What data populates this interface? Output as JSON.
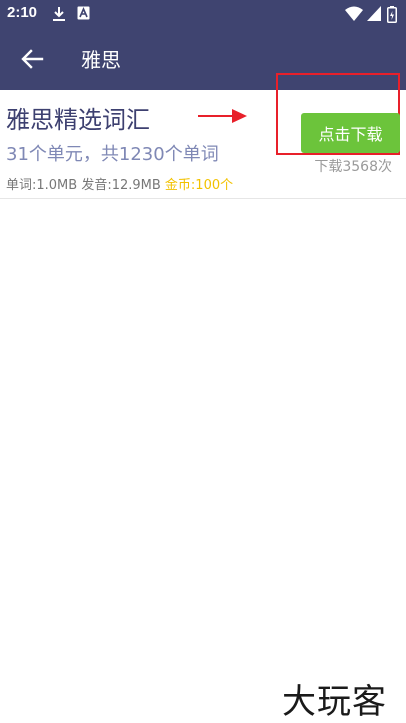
{
  "status_bar": {
    "time": "2:10",
    "icons": [
      "download-icon",
      "a-badge-icon",
      "wifi-icon",
      "signal-icon",
      "battery-icon"
    ]
  },
  "app_bar": {
    "title": "雅思",
    "back_icon": "arrow-left-icon"
  },
  "vocab_item": {
    "title": "雅思精选词汇",
    "subtitle": "31个单元，共1230个单词",
    "sizes": "单词:1.0MB 发音:12.9MB ",
    "coins": "金币:100个",
    "download_button_label": "点击下载",
    "download_count": "下载3568次"
  },
  "annotations": {
    "arrow_color": "#e8202a",
    "box_color": "#e8202a"
  },
  "watermark": {
    "text": "大玩客"
  },
  "colors": {
    "app_bar": "#3f4470",
    "title_text": "#3d4070",
    "subtitle_text": "#7f88b5",
    "button": "#6cc43b",
    "coins": "#f2c200"
  }
}
